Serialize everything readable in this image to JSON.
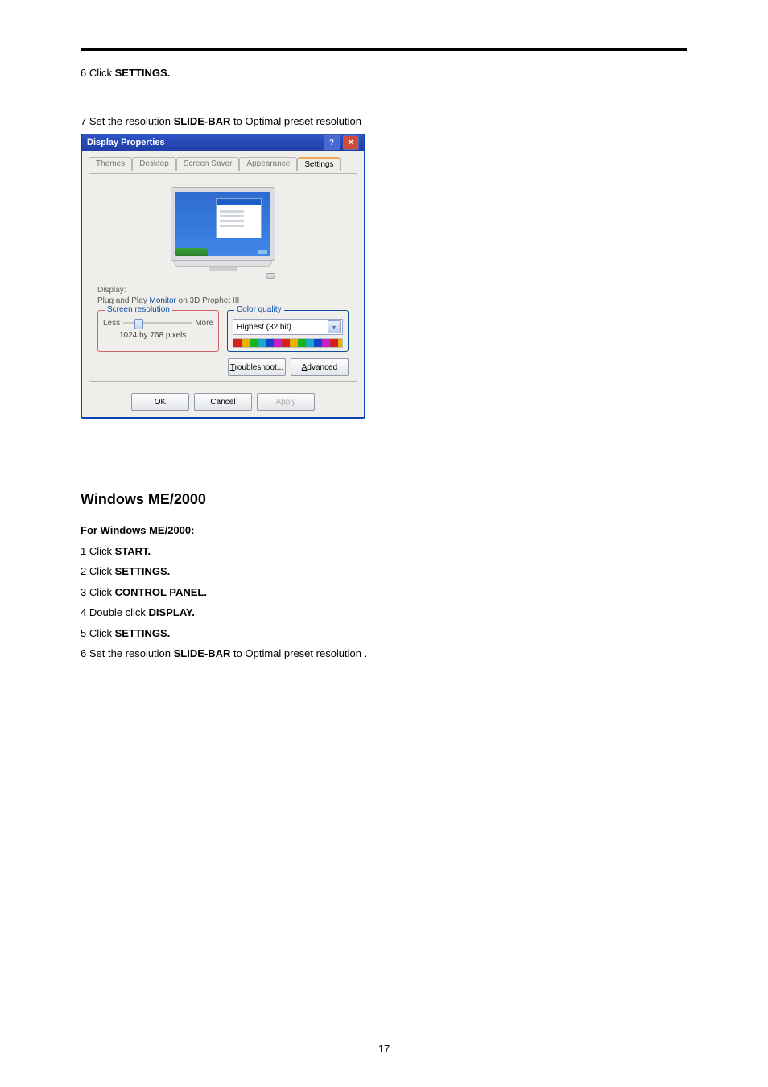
{
  "step6": {
    "before": "6 Click ",
    "bold": "SETTINGS."
  },
  "step7": {
    "before": "7 Set the resolution ",
    "bold": "SLIDE-BAR",
    "after": " to Optimal preset resolution"
  },
  "dialog": {
    "title": "Display Properties",
    "tabs": [
      "Themes",
      "Desktop",
      "Screen Saver",
      "Appearance",
      "Settings"
    ],
    "display_label": "Display:",
    "display_value_prefix": "Plug and Play ",
    "display_value_link": "Monitor",
    "display_value_suffix": " on 3D Prophet III",
    "screen_res": {
      "legend": "Screen resolution",
      "less": "Less",
      "more": "More",
      "value": "1024 by 768 pixels"
    },
    "color_quality": {
      "legend": "Color quality",
      "value": "Highest (32 bit)"
    },
    "troubleshoot_t": "T",
    "troubleshoot_rest": "roubleshoot...",
    "advanced_a": "A",
    "advanced_rest": "dvanced",
    "ok": "OK",
    "cancel": "Cancel",
    "apply": "Apply"
  },
  "section_heading": "Windows ME/2000",
  "section_sub": "For Windows ME/2000:",
  "me_steps": [
    {
      "before": "1 Click ",
      "bold": "START."
    },
    {
      "before": "2 Click ",
      "bold": "SETTINGS."
    },
    {
      "before": "3 Click ",
      "bold": "CONTROL PANEL."
    },
    {
      "before": "4 Double click ",
      "bold": "DISPLAY."
    },
    {
      "before": "5 Click ",
      "bold": "SETTINGS."
    },
    {
      "before": "6 Set the resolution ",
      "bold": "SLIDE-BAR",
      "after": " to  Optimal preset resolution ."
    }
  ],
  "page_number": "17"
}
